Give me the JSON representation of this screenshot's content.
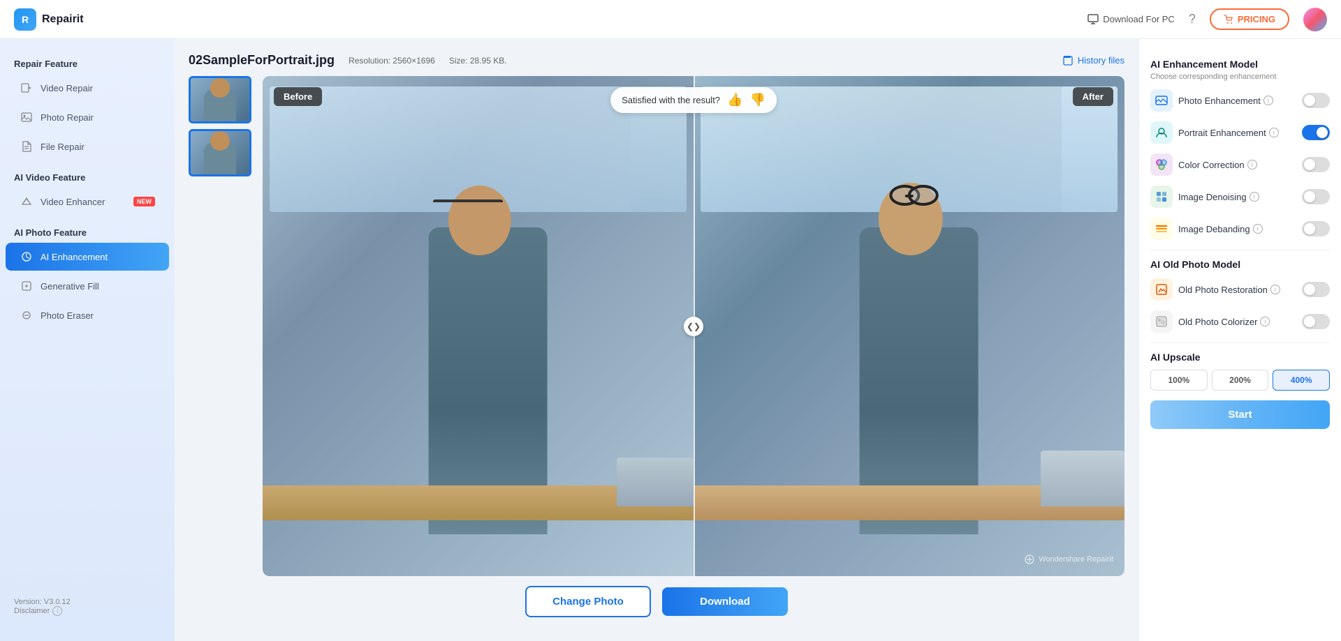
{
  "app": {
    "name": "Repairit",
    "version": "Version: V3.0.12"
  },
  "header": {
    "logo_text": "Repairit",
    "download_pc_label": "Download For PC",
    "pricing_label": "PRICING"
  },
  "sidebar": {
    "sections": [
      {
        "label": "Repair Feature",
        "items": [
          {
            "id": "video-repair",
            "label": "Video Repair",
            "icon": "▶",
            "active": false
          },
          {
            "id": "photo-repair",
            "label": "Photo Repair",
            "icon": "🖼",
            "active": false
          },
          {
            "id": "file-repair",
            "label": "File Repair",
            "icon": "📄",
            "active": false
          }
        ]
      },
      {
        "label": "AI Video Feature",
        "items": [
          {
            "id": "video-enhancer",
            "label": "Video Enhancer",
            "icon": "✨",
            "active": false,
            "badge": "NEW"
          }
        ]
      },
      {
        "label": "AI Photo Feature",
        "items": [
          {
            "id": "ai-enhancement",
            "label": "AI Enhancement",
            "icon": "⚡",
            "active": true
          },
          {
            "id": "generative-fill",
            "label": "Generative Fill",
            "icon": "◇",
            "active": false
          },
          {
            "id": "photo-eraser",
            "label": "Photo Eraser",
            "icon": "◯",
            "active": false
          }
        ]
      }
    ],
    "version": "Version: V3.0.12",
    "disclaimer": "Disclaimer"
  },
  "file_info": {
    "name": "02SampleForPortrait.jpg",
    "resolution": "Resolution: 2560×1696",
    "size": "Size: 28.95 KB."
  },
  "history": {
    "label": "History files"
  },
  "viewer": {
    "before_label": "Before",
    "after_label": "After",
    "satisfied_text": "Satisfied with the result?",
    "watermark": "Wondershare Repairit"
  },
  "actions": {
    "change_photo": "Change Photo",
    "download": "Download"
  },
  "right_panel": {
    "ai_enhancement_title": "AI Enhancement Model",
    "ai_enhancement_subtitle": "Choose corresponding enhancement",
    "enhancement_items": [
      {
        "id": "photo-enhancement",
        "label": "Photo Enhancement",
        "icon": "🏔",
        "color": "blue",
        "enabled": false
      },
      {
        "id": "portrait-enhancement",
        "label": "Portrait Enhancement",
        "icon": "👤",
        "color": "teal",
        "enabled": true
      },
      {
        "id": "color-correction",
        "label": "Color Correction",
        "icon": "🎨",
        "color": "purple",
        "enabled": false
      },
      {
        "id": "image-denoising",
        "label": "Image Denoising",
        "icon": "🔷",
        "color": "green",
        "enabled": false
      },
      {
        "id": "image-debanding",
        "label": "Image Debanding",
        "icon": "📊",
        "color": "yellow",
        "enabled": false
      }
    ],
    "old_photo_title": "AI Old Photo Model",
    "old_photo_items": [
      {
        "id": "old-photo-restoration",
        "label": "Old Photo Restoration",
        "icon": "🖼",
        "color": "orange",
        "enabled": false
      },
      {
        "id": "old-photo-colorizer",
        "label": "Old Photo Colorizer",
        "icon": "🎭",
        "color": "gray",
        "enabled": false
      }
    ],
    "ai_upscale_title": "AI Upscale",
    "upscale_options": [
      {
        "label": "100%",
        "value": "100",
        "active": false
      },
      {
        "label": "200%",
        "value": "200",
        "active": false
      },
      {
        "label": "400%",
        "value": "400",
        "active": true
      }
    ],
    "start_label": "Start"
  }
}
